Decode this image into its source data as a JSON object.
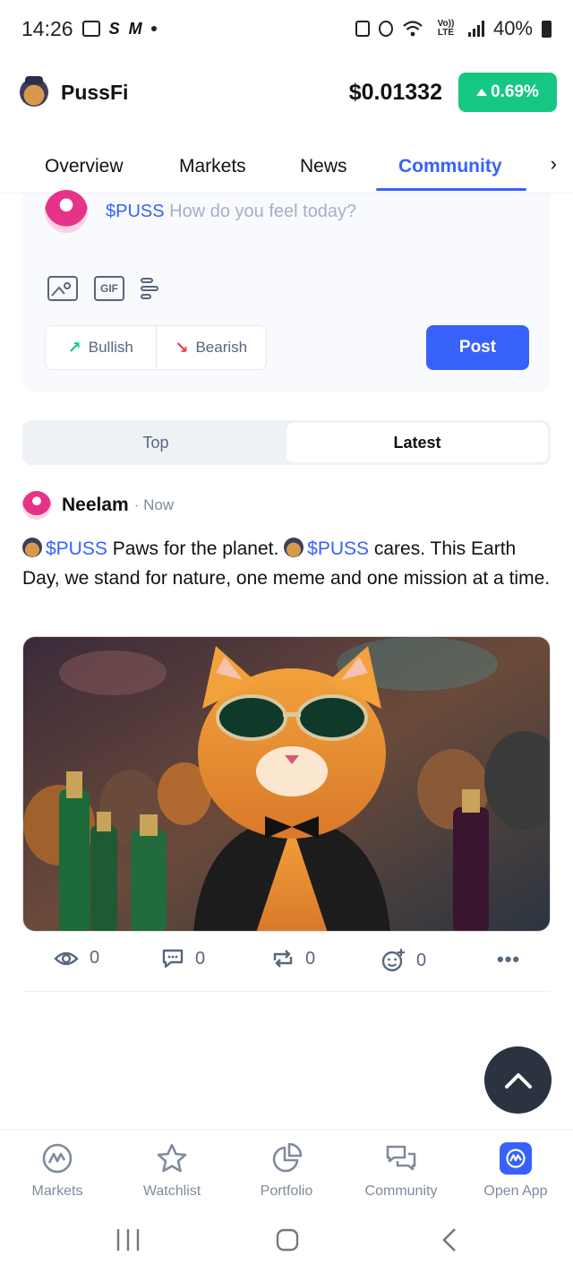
{
  "status_bar": {
    "time": "14:26",
    "left_letters": [
      "S",
      "M"
    ],
    "battery": "40%",
    "network": "Vo)) LTE"
  },
  "header": {
    "app_name": "PussFi",
    "price": "$0.01332",
    "change": "0.69%",
    "change_color": "#16c784"
  },
  "tabs": [
    {
      "label": "Overview",
      "active": false
    },
    {
      "label": "Markets",
      "active": false
    },
    {
      "label": "News",
      "active": false
    },
    {
      "label": "Community",
      "active": true
    }
  ],
  "composer": {
    "ticker": "$PUSS",
    "placeholder": "How do you feel today?",
    "gif_label": "GIF",
    "bullish_label": "Bullish",
    "bearish_label": "Bearish",
    "post_label": "Post"
  },
  "feed_toggle": {
    "top": "Top",
    "latest": "Latest",
    "selected": "Latest"
  },
  "post": {
    "author": "Neelam",
    "time": "· Now",
    "ticker": "$PUSS",
    "text_1": " Paws for the planet. ",
    "text_2": " cares. This Earth Day, we stand for nature, one meme and one mission at a time.",
    "image_subject": "cat in sunglasses and tuxedo with champagne bottles and crowd",
    "views": "0",
    "comments": "0",
    "reposts": "0",
    "reactions": "0"
  },
  "bottom_nav": [
    {
      "label": "Markets",
      "icon": "coinmarketcap-logo-icon"
    },
    {
      "label": "Watchlist",
      "icon": "star-icon"
    },
    {
      "label": "Portfolio",
      "icon": "pie-chart-icon"
    },
    {
      "label": "Community",
      "icon": "chat-bubbles-icon"
    },
    {
      "label": "Open App",
      "icon": "app-logo-icon"
    }
  ],
  "colors": {
    "accent": "#3861fb",
    "positive": "#16c784",
    "negative": "#ea3943",
    "muted": "#58667e"
  }
}
